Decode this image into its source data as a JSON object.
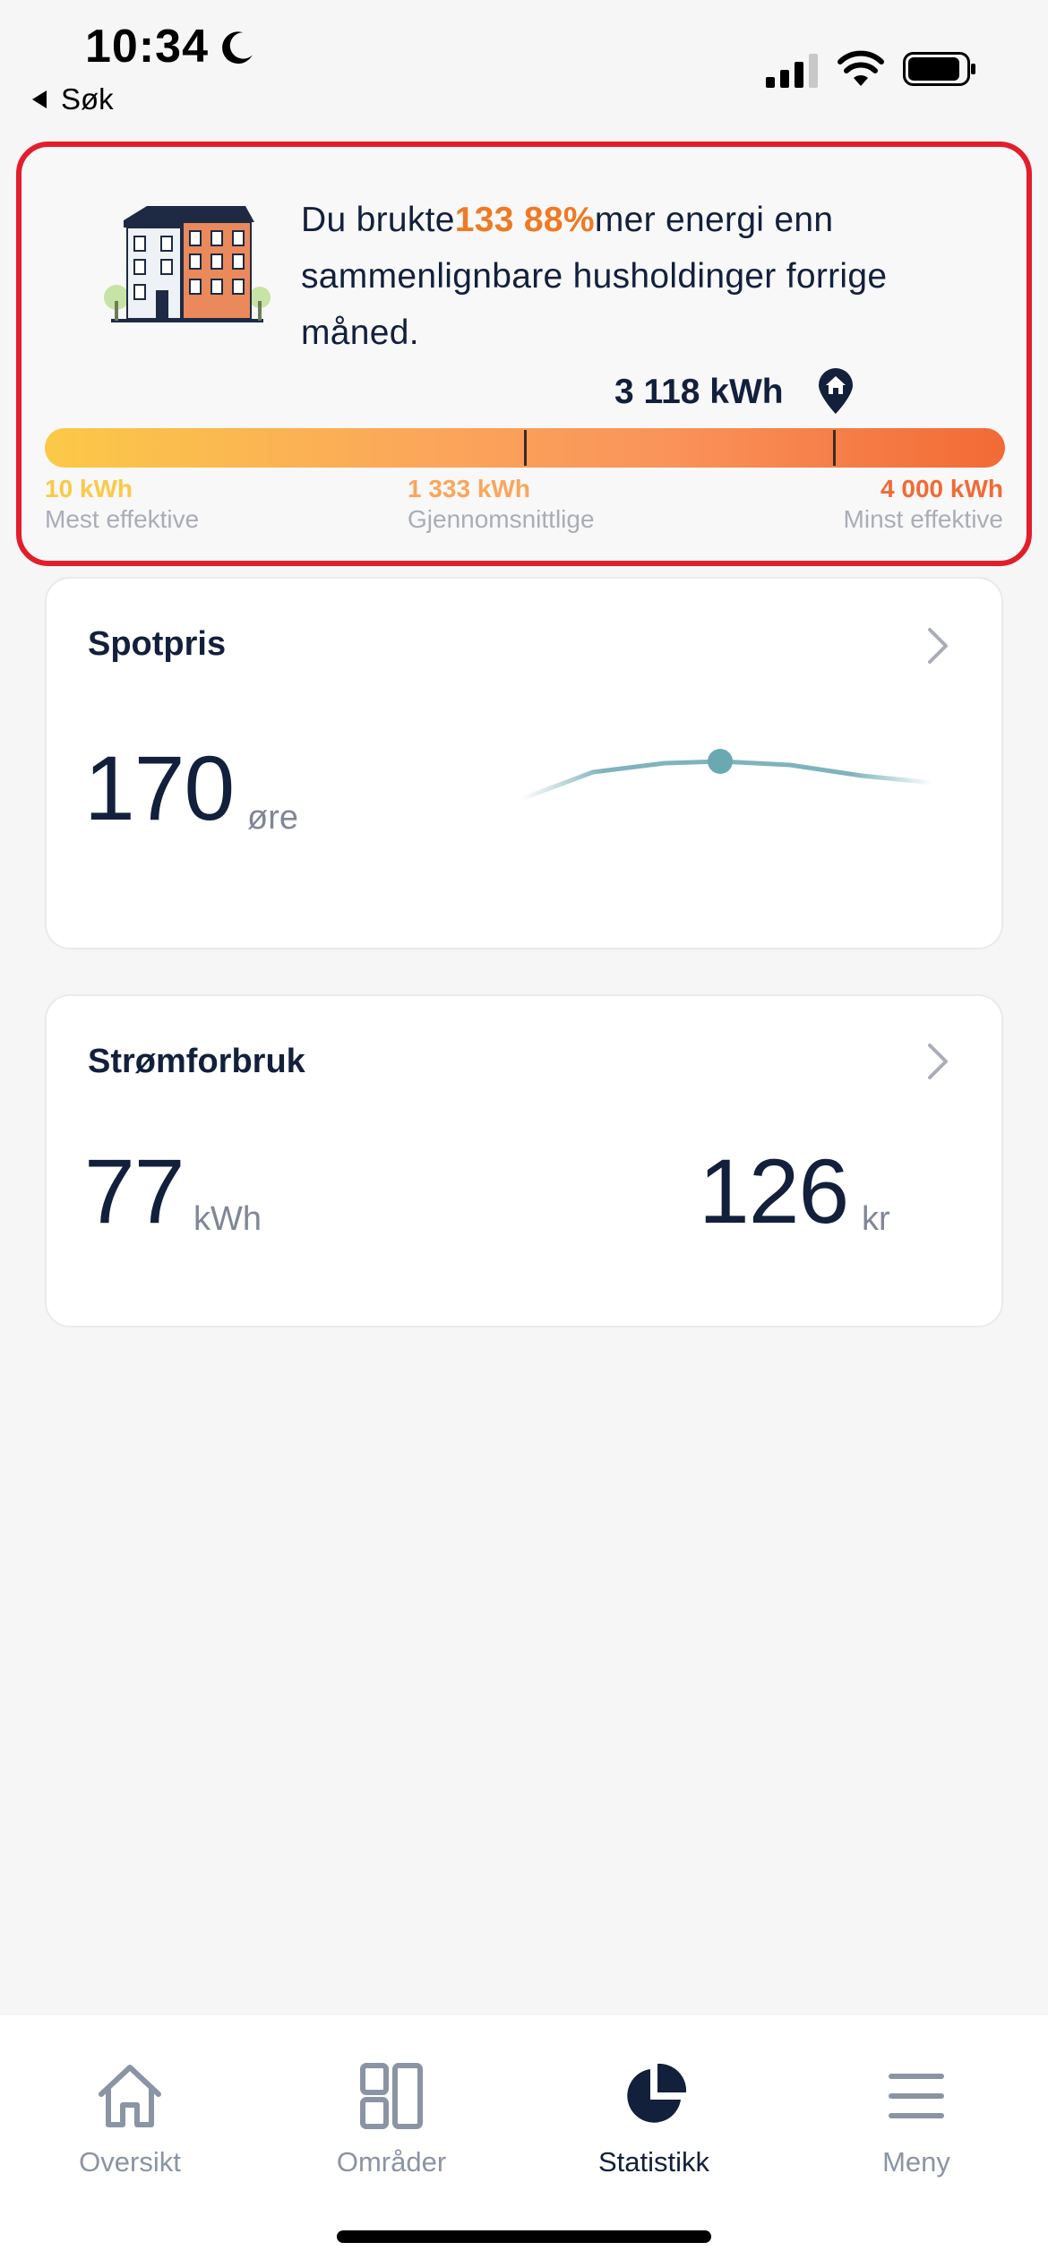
{
  "status_bar": {
    "time": "10:34",
    "back_label": "Søk"
  },
  "comparison": {
    "text_before": "Du brukte",
    "highlight": "133 88%",
    "text_after": "mer  energi enn sammenlignbare husholdinger forrige måned.",
    "usage_value": "3 118 kWh",
    "scale": {
      "min_value": "10 kWh",
      "min_label": "Mest effektive",
      "avg_value": "1 333 kWh",
      "avg_label": "Gjennomsnittlige",
      "max_value": "4 000 kWh",
      "max_label": "Minst effektive"
    },
    "colors": {
      "highlight": "#ee7a24",
      "min": "#fbc947",
      "avg": "#fba65a",
      "max": "#f26a35",
      "border": "#e31e2c"
    }
  },
  "spotpris": {
    "title": "Spotpris",
    "value": "170",
    "unit": "øre"
  },
  "stromforbruk": {
    "title": "Strømforbruk",
    "energy_value": "77",
    "energy_unit": "kWh",
    "cost_value": "126",
    "cost_unit": "kr"
  },
  "tab_bar": {
    "tabs": [
      {
        "label": "Oversikt",
        "icon": "home-icon"
      },
      {
        "label": "Områder",
        "icon": "grid-icon"
      },
      {
        "label": "Statistikk",
        "icon": "pie-chart-icon",
        "active": true
      },
      {
        "label": "Meny",
        "icon": "menu-icon"
      }
    ]
  }
}
